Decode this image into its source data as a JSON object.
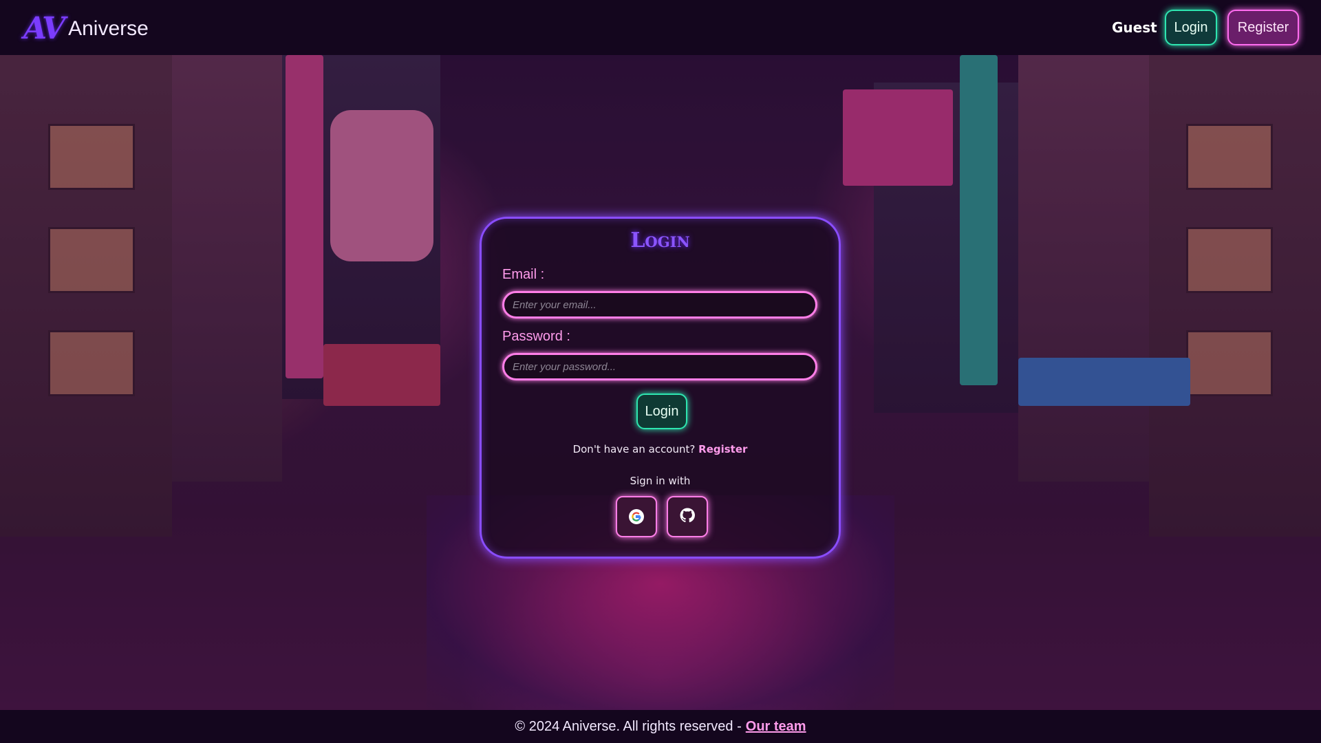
{
  "navbar": {
    "logo_mark": "AV",
    "logo_text": "Aniverse",
    "user_label": "Guest",
    "login_button": "Login",
    "register_button": "Register"
  },
  "login_card": {
    "title": "Login",
    "email_label": "Email :",
    "email_placeholder": "Enter your email...",
    "email_value": "",
    "password_label": "Password :",
    "password_placeholder": "Enter your password...",
    "password_value": "",
    "submit_button": "Login",
    "no_account_text": "Don't have an account?",
    "register_link": "Register",
    "sign_in_with": "Sign in with",
    "social": [
      {
        "name": "google-icon"
      },
      {
        "name": "github-icon"
      }
    ]
  },
  "footer": {
    "copyright": "© 2024 Aniverse. All rights reserved -",
    "team_link": "Our team"
  },
  "colors": {
    "accent_purple": "#8a4dff",
    "accent_pink": "#ff7ee8",
    "accent_teal": "#2ee6b0",
    "background": "#14061e"
  }
}
